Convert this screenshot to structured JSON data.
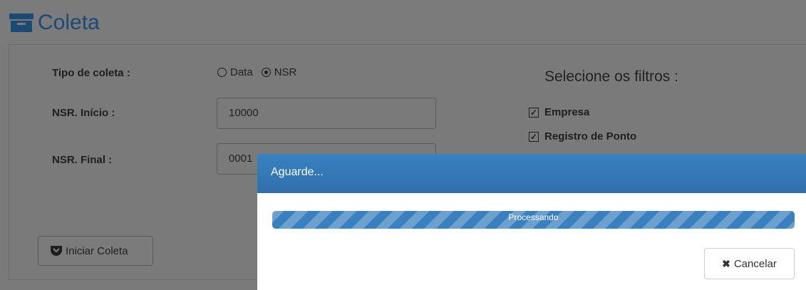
{
  "page": {
    "title": "Coleta"
  },
  "form": {
    "tipo_label": "Tipo de coleta :",
    "options": [
      {
        "label": "Data",
        "selected": false
      },
      {
        "label": "NSR",
        "selected": true
      }
    ],
    "nsr_inicio_label": "NSR. Início :",
    "nsr_inicio_value": "10000",
    "nsr_final_label": "NSR. Final :",
    "nsr_final_value": "0001",
    "start_button_label": "Iniciar Coleta"
  },
  "filters": {
    "title": "Selecione os filtros :",
    "items": [
      {
        "label": "Empresa",
        "checked": true
      },
      {
        "label": "Registro de Ponto",
        "checked": true
      }
    ]
  },
  "modal": {
    "title": "Aguarde...",
    "progress_label": "Processando",
    "progress_percent": 100,
    "cancel_label": "Cancelar",
    "accent_color": "#3177b5"
  }
}
